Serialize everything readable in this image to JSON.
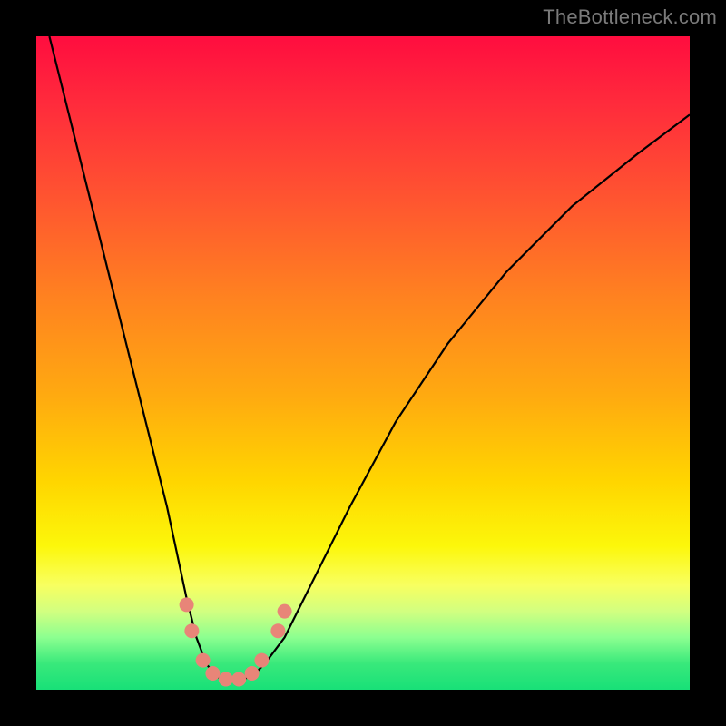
{
  "watermark": "TheBottleneck.com",
  "chart_data": {
    "type": "line",
    "title": "",
    "xlabel": "",
    "ylabel": "",
    "xlim": [
      0,
      100
    ],
    "ylim": [
      0,
      100
    ],
    "grid": false,
    "series": [
      {
        "name": "bottleneck-curve",
        "x": [
          2,
          5,
          8,
          11,
          14,
          17,
          20,
          23,
          24.5,
          26,
          27.5,
          29,
          31,
          33,
          35,
          38,
          42,
          48,
          55,
          63,
          72,
          82,
          92,
          100
        ],
        "y": [
          100,
          88,
          76,
          64,
          52,
          40,
          28,
          14,
          8,
          4,
          2,
          1.5,
          1.5,
          2,
          4,
          8,
          16,
          28,
          41,
          53,
          64,
          74,
          82,
          88
        ]
      }
    ],
    "markers": [
      {
        "name": "marker-1",
        "x": 23.0,
        "y": 13.0
      },
      {
        "name": "marker-2",
        "x": 23.8,
        "y": 9.0
      },
      {
        "name": "marker-3",
        "x": 25.5,
        "y": 4.5
      },
      {
        "name": "marker-4",
        "x": 27.0,
        "y": 2.5
      },
      {
        "name": "marker-5",
        "x": 29.0,
        "y": 1.6
      },
      {
        "name": "marker-6",
        "x": 31.0,
        "y": 1.6
      },
      {
        "name": "marker-7",
        "x": 33.0,
        "y": 2.5
      },
      {
        "name": "marker-8",
        "x": 34.5,
        "y": 4.5
      },
      {
        "name": "marker-9",
        "x": 37.0,
        "y": 9.0
      },
      {
        "name": "marker-10",
        "x": 38.0,
        "y": 12.0
      }
    ],
    "marker_color": "#e88578",
    "curve_color": "#000000",
    "gradient_stops": [
      {
        "pos": 0,
        "color": "#ff0d3f"
      },
      {
        "pos": 0.55,
        "color": "#ffaa10"
      },
      {
        "pos": 0.78,
        "color": "#fcf70a"
      },
      {
        "pos": 1.0,
        "color": "#18e078"
      }
    ]
  }
}
